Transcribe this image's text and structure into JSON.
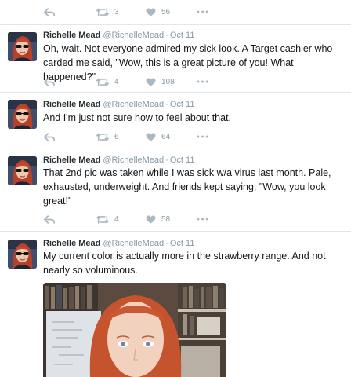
{
  "colors": {
    "action": "#aab8c2",
    "name": "#292f33",
    "meta": "#8899a6",
    "text": "#14171a",
    "divider": "#e1e8ed"
  },
  "icons": {
    "reply": "reply-icon",
    "retweet": "retweet-icon",
    "like": "heart-icon",
    "more": "more-dots-icon"
  },
  "top_actions": {
    "retweets": "3",
    "likes": "56"
  },
  "tweets": [
    {
      "name": "Richelle Mead",
      "handle": "@RichelleMead",
      "sep": "·",
      "time": "Oct 11",
      "text": "Oh, wait. Not everyone admired my sick look. A Target cashier who carded me said, \"Wow, this is a great picture of you! What happened?\"",
      "retweets": "4",
      "likes": "108"
    },
    {
      "name": "Richelle Mead",
      "handle": "@RichelleMead",
      "sep": "·",
      "time": "Oct 11",
      "text": "And I'm just not sure how to feel about that.",
      "retweets": "6",
      "likes": "64"
    },
    {
      "name": "Richelle Mead",
      "handle": "@RichelleMead",
      "sep": "·",
      "time": "Oct 11",
      "text": "That 2nd pic was taken while I was sick w/a virus last month. Pale, exhausted, underweight. And friends kept saying, \"Wow, you look great!\"",
      "retweets": "4",
      "likes": "58"
    },
    {
      "name": "Richelle Mead",
      "handle": "@RichelleMead",
      "sep": "·",
      "time": "Oct 11",
      "text": "My current color is actually more in the strawberry range. And not nearly so voluminous."
    }
  ]
}
